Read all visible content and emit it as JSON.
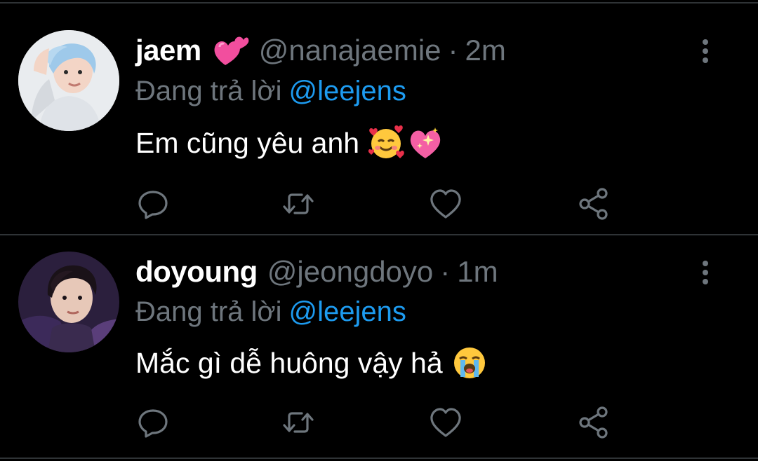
{
  "tweets": [
    {
      "name": "jaem",
      "name_emoji": "two-hearts-emoji",
      "handle": "@nanajaemie",
      "separator": "·",
      "time": "2m",
      "reply_label": "Đang trả lời",
      "reply_mention": "@leejens",
      "text": "Em cũng yêu anh",
      "text_emojis": [
        "smiling-face-with-hearts-emoji",
        "sparkling-heart-emoji"
      ]
    },
    {
      "name": "doyoung",
      "handle": "@jeongdoyo",
      "separator": "·",
      "time": "1m",
      "reply_label": "Đang trả lời",
      "reply_mention": "@leejens",
      "text": "Mắc gì dễ huông vậy hả",
      "text_emojis": [
        "loudly-crying-face-emoji"
      ]
    }
  ],
  "icons": {
    "more": "more-vertical-icon",
    "reply": "reply-icon",
    "retweet": "retweet-icon",
    "like": "heart-icon",
    "share": "share-icon"
  },
  "colors": {
    "background": "#000000",
    "text": "#ffffff",
    "secondary": "#6e767d",
    "mention": "#1d9bf0",
    "divider": "#2f3336"
  }
}
